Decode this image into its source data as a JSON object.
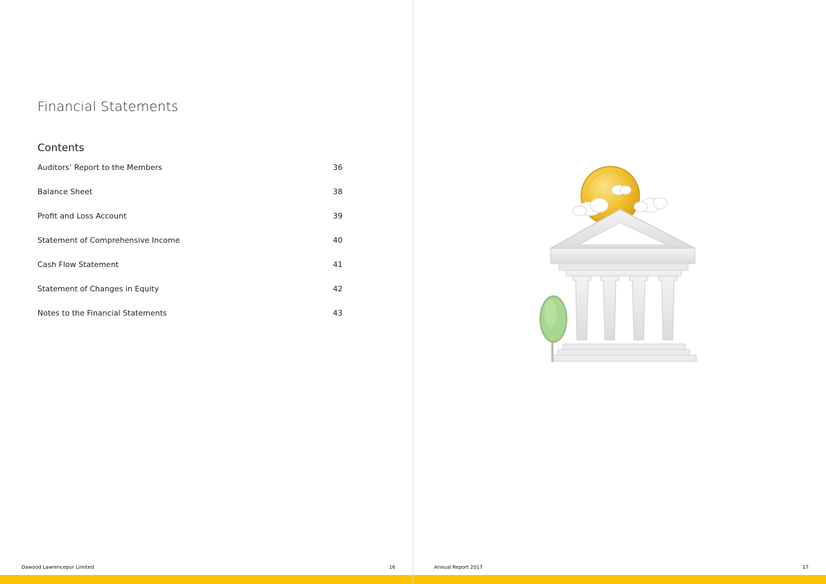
{
  "left_page": {
    "title": "Financial Statements",
    "contents_heading": "Contents",
    "toc": [
      {
        "label": "Auditors’ Report to the Members",
        "page": "36"
      },
      {
        "label": "Balance Sheet",
        "page": "38"
      },
      {
        "label": "Profit and Loss Account",
        "page": "39"
      },
      {
        "label": "Statement of Comprehensive Income",
        "page": "40"
      },
      {
        "label": "Cash Flow Statement",
        "page": "41"
      },
      {
        "label": "Statement of Changes in Equity",
        "page": "42"
      },
      {
        "label": "Notes to the Financial Statements",
        "page": "43"
      }
    ],
    "footer": {
      "company": "Dawood Lawrencepur Limited",
      "page_number": "16"
    }
  },
  "right_page": {
    "illustration": "bank-building-with-coin-and-tree",
    "footer": {
      "report": "Annual Report 2017",
      "page_number": "17"
    }
  },
  "colors": {
    "accent_bar": "#fcc400",
    "coin": "#f2c12e",
    "building": "#e6e6e6",
    "tree": "#a8d890"
  }
}
